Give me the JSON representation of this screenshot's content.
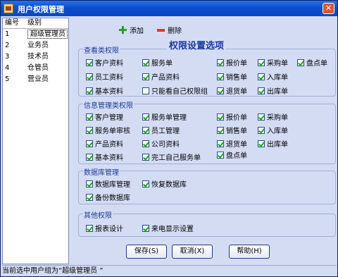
{
  "window": {
    "title": "用户权限管理",
    "close": "✕"
  },
  "list": {
    "headers": [
      "编号",
      "级别"
    ],
    "rows": [
      {
        "id": "1",
        "level": "超级管理员"
      },
      {
        "id": "2",
        "level": "业务员"
      },
      {
        "id": "3",
        "level": "技术员"
      },
      {
        "id": "4",
        "level": "仓管员"
      },
      {
        "id": "5",
        "level": "营业员"
      }
    ]
  },
  "toolbar": {
    "add_label": "添加",
    "delete_label": "删除"
  },
  "panel_title": "权限设置选项",
  "groups": {
    "view": {
      "label": "查看类权限",
      "items": [
        {
          "label": "客户资料",
          "checked": true
        },
        {
          "label": "服务单",
          "checked": true
        },
        {
          "label": "报价单",
          "checked": true
        },
        {
          "label": "采购单",
          "checked": true
        },
        {
          "label": "盘点单",
          "checked": true
        },
        {
          "label": "员工资料",
          "checked": true
        },
        {
          "label": "产品资料",
          "checked": true
        },
        {
          "label": "销售单",
          "checked": true
        },
        {
          "label": "入库单",
          "checked": true
        },
        {
          "label": "基本资料",
          "checked": true
        },
        {
          "label": "只能看自己权限组",
          "checked": false
        },
        {
          "label": "退货单",
          "checked": true
        },
        {
          "label": "出库单",
          "checked": true
        }
      ]
    },
    "info": {
      "label": "信息管理类权限",
      "items": [
        {
          "label": "客户管理",
          "checked": true
        },
        {
          "label": "服务单管理",
          "checked": true
        },
        {
          "label": "报价单",
          "checked": true
        },
        {
          "label": "采购单",
          "checked": true
        },
        {
          "label": "服务单审核",
          "checked": true
        },
        {
          "label": "员工管理",
          "checked": true
        },
        {
          "label": "销售单",
          "checked": true
        },
        {
          "label": "入库单",
          "checked": true
        },
        {
          "label": "产品资料",
          "checked": true
        },
        {
          "label": "公司资料",
          "checked": true
        },
        {
          "label": "退货单",
          "checked": true
        },
        {
          "label": "出库单",
          "checked": true
        },
        {
          "label": "基本资料",
          "checked": true
        },
        {
          "label": "完工自己服务单",
          "checked": true
        },
        {
          "label": "盘点单",
          "checked": true
        }
      ]
    },
    "db": {
      "label": "数据库管理",
      "items": [
        {
          "label": "数据库管理",
          "checked": true
        },
        {
          "label": "恢复数据库",
          "checked": true
        },
        {
          "label": "备份数据库",
          "checked": true
        }
      ]
    },
    "other": {
      "label": "其他权限",
      "items": [
        {
          "label": "报表设计",
          "checked": true
        },
        {
          "label": "来电显示设置",
          "checked": true
        }
      ]
    }
  },
  "buttons": {
    "save": "保存(S)",
    "cancel": "取消(X)",
    "help": "帮助(H)"
  },
  "status": "当前选中用户组为“超级管理员 ”"
}
